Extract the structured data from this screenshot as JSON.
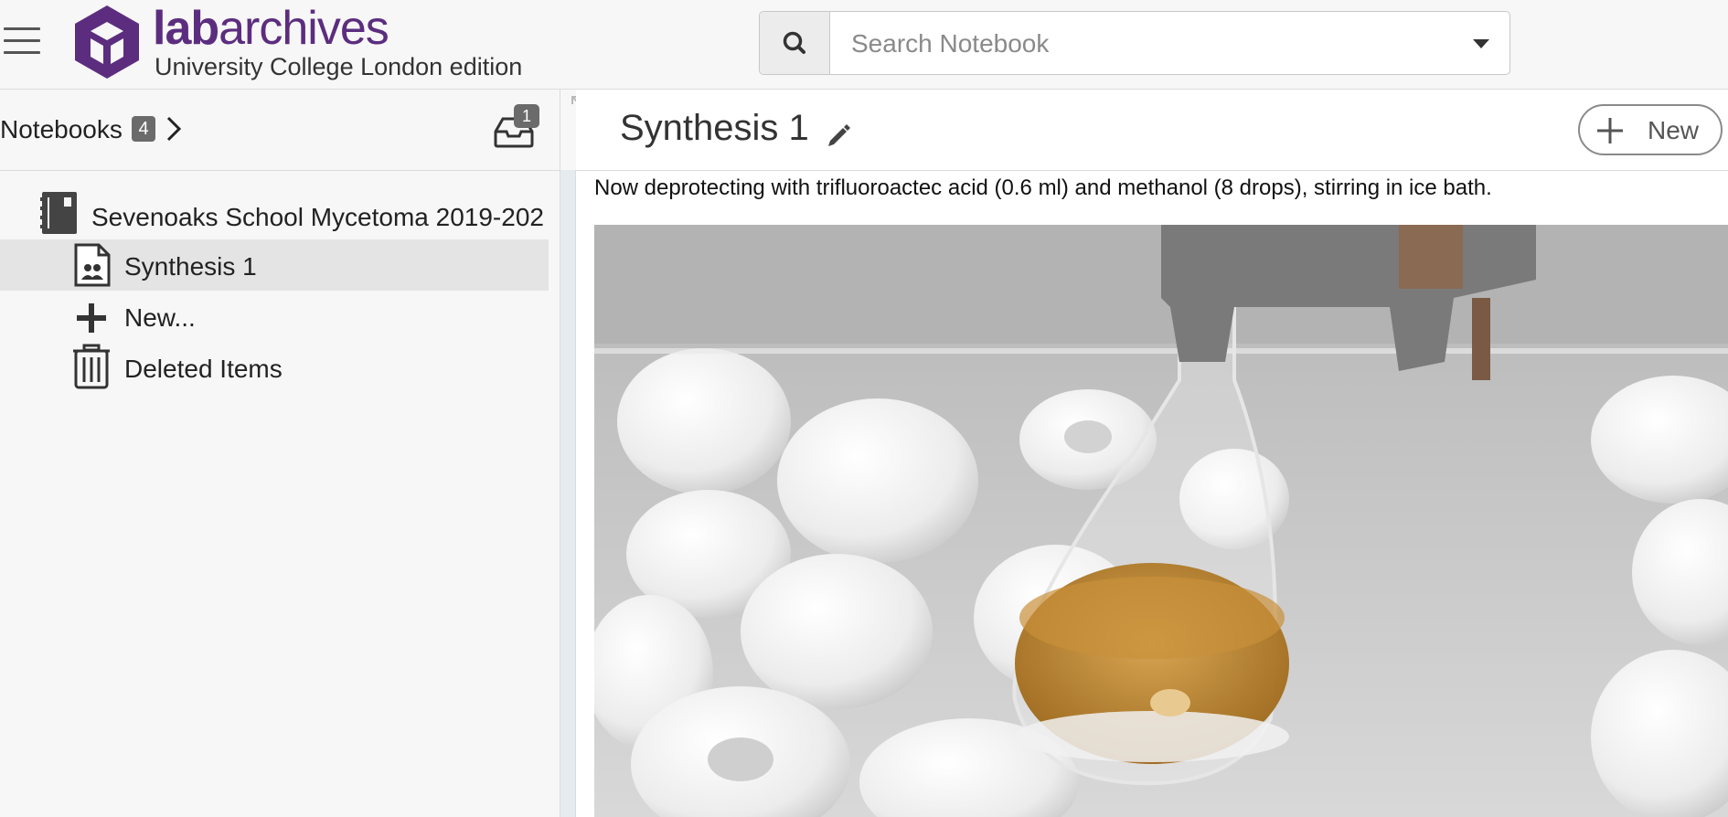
{
  "header": {
    "menu_icon": "hamburger-icon",
    "logo_icon": "labarchives-cube-logo",
    "brand_bold": "lab",
    "brand_rest": "archives",
    "edition": "University College London edition",
    "search": {
      "placeholder": "Search Notebook",
      "value": "",
      "icon": "search-icon"
    }
  },
  "sidebar": {
    "notebooks_label": "Notebooks",
    "notebooks_count": "4",
    "inbox_badge": "1",
    "tree": {
      "notebook": "Sevenoaks School Mycetoma 2019-202",
      "page": "Synthesis 1",
      "new_item": "New...",
      "deleted": "Deleted Items"
    }
  },
  "main": {
    "title": "Synthesis 1",
    "new_button": "New",
    "entry_text": "Now deprotecting with trifluoroactec acid (0.6 ml) and methanol (8 drops), stirring in ice bath."
  },
  "colors": {
    "brand_purple": "#5c2d7f",
    "badge_gray": "#6b6b6b",
    "selected_row": "#e4e4e4"
  }
}
